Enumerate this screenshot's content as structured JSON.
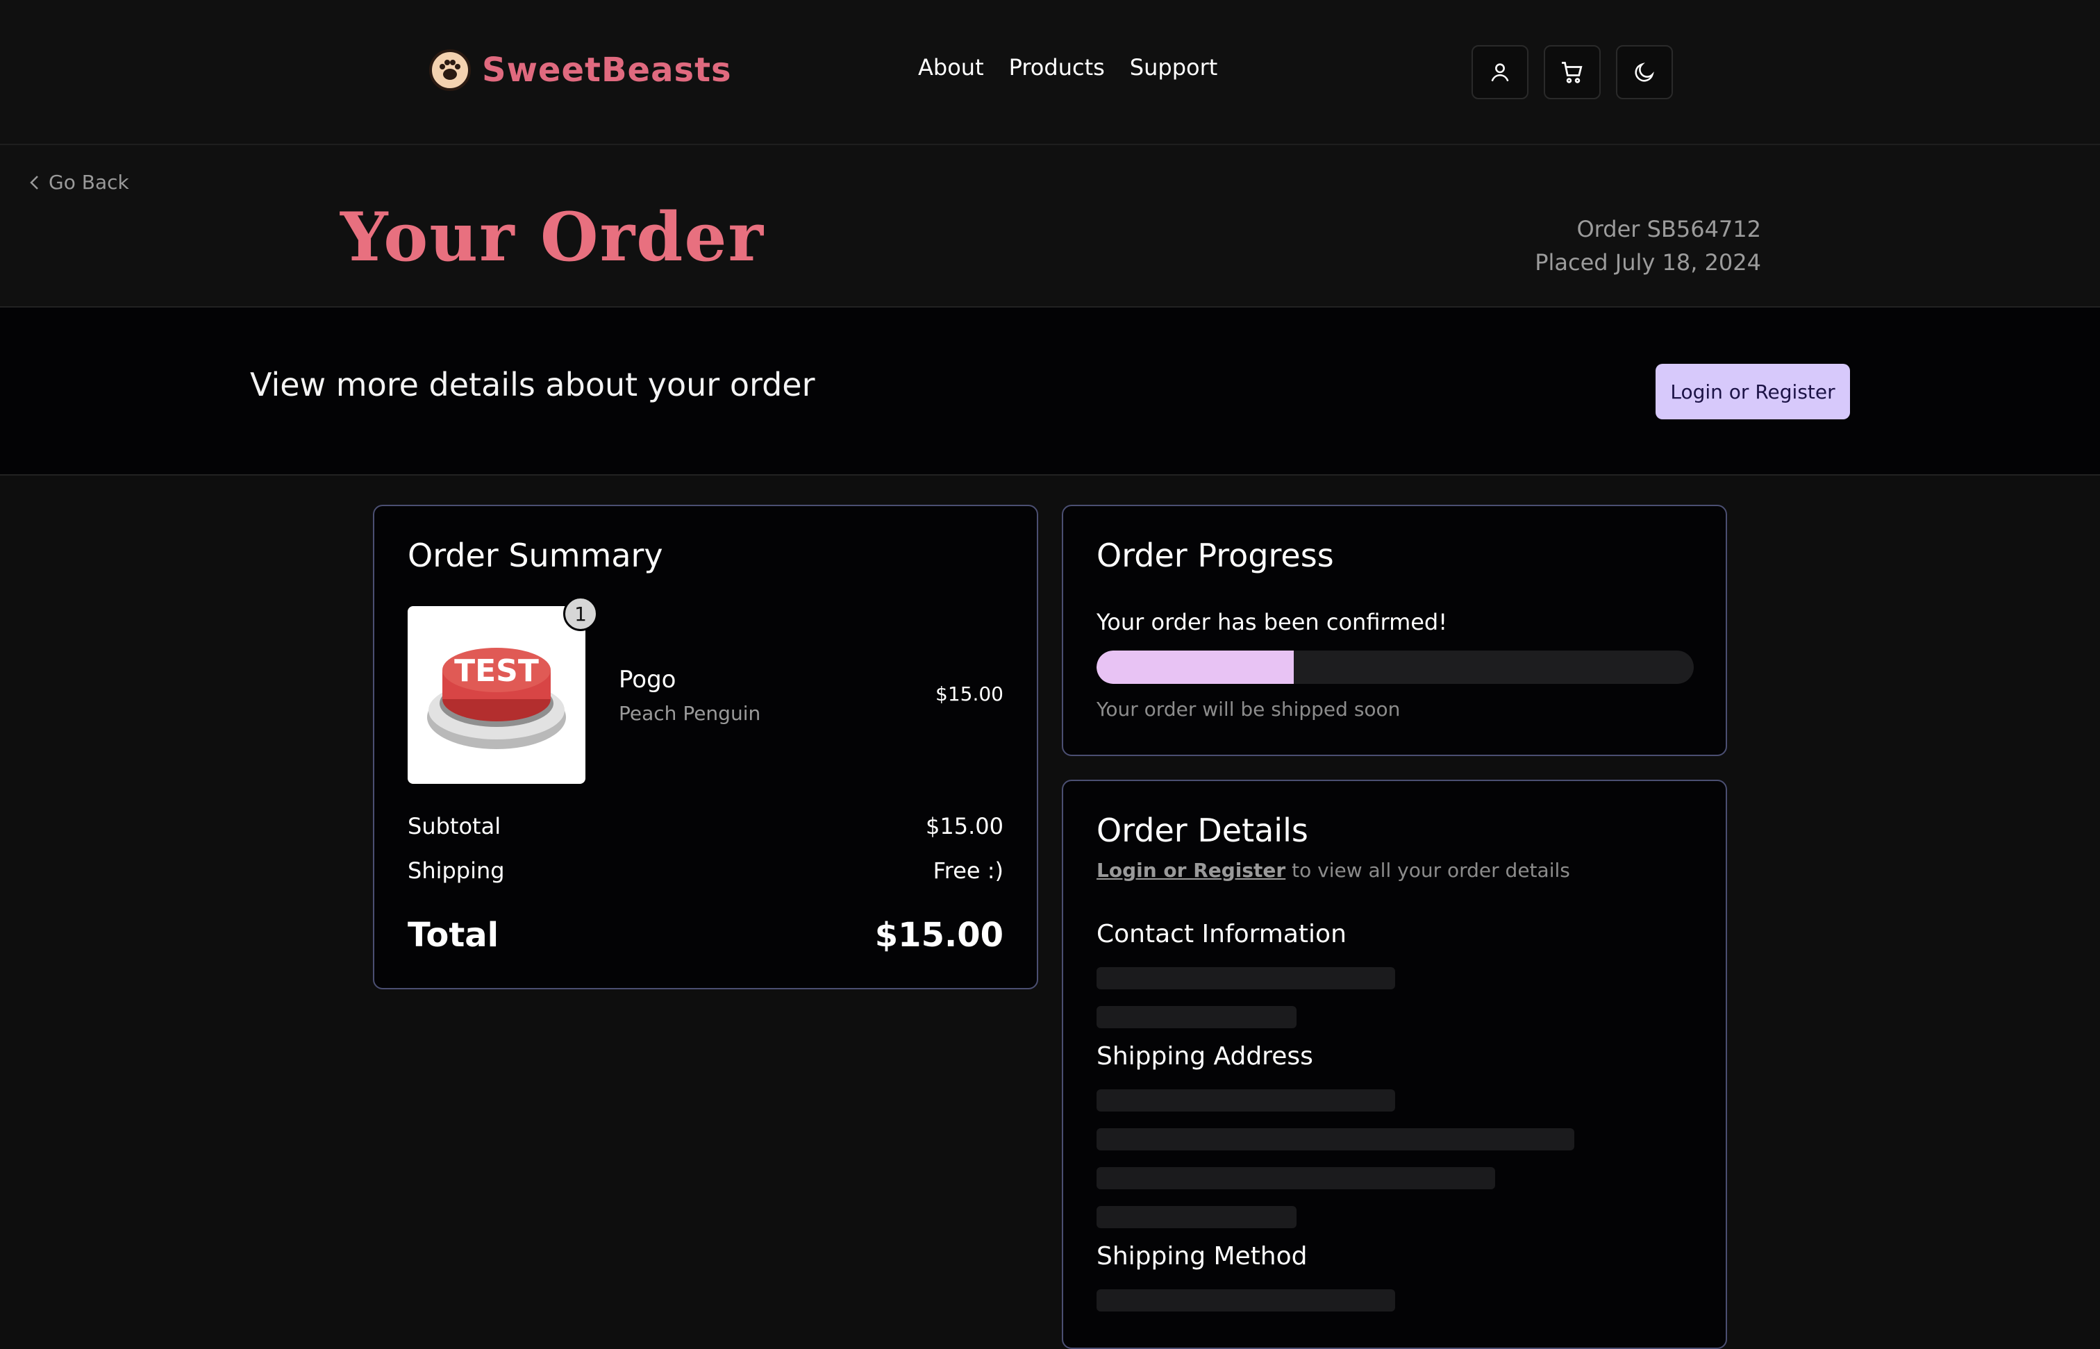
{
  "brand": {
    "name": "SweetBeasts"
  },
  "nav": {
    "links": [
      "About",
      "Products",
      "Support"
    ]
  },
  "header": {
    "back_label": "Go Back",
    "title": "Your Order",
    "order_number": "Order SB564712",
    "placed": "Placed July 18, 2024"
  },
  "banner": {
    "text": "View more details about your order",
    "button": "Login or Register"
  },
  "summary": {
    "title": "Order Summary",
    "item": {
      "image_text": "TEST",
      "quantity": "1",
      "name": "Pogo",
      "variant": "Peach Penguin",
      "price": "$15.00"
    },
    "subtotal_label": "Subtotal",
    "subtotal_value": "$15.00",
    "shipping_label": "Shipping",
    "shipping_value": "Free :)",
    "total_label": "Total",
    "total_value": "$15.00"
  },
  "progress": {
    "title": "Order Progress",
    "status": "Your order has been confirmed!",
    "fraction": 0.33,
    "note": "Your order will be shipped soon"
  },
  "details": {
    "title": "Order Details",
    "login_link": "Login or Register",
    "login_suffix": " to view all your order details",
    "contact_heading": "Contact Information",
    "shipping_address_heading": "Shipping Address",
    "shipping_method_heading": "Shipping Method"
  },
  "colors": {
    "brand": "#e06a7f",
    "accent_button": "#d7c9fb",
    "progress_fill": "#e8c3f4",
    "card_border": "#4b4f72"
  }
}
